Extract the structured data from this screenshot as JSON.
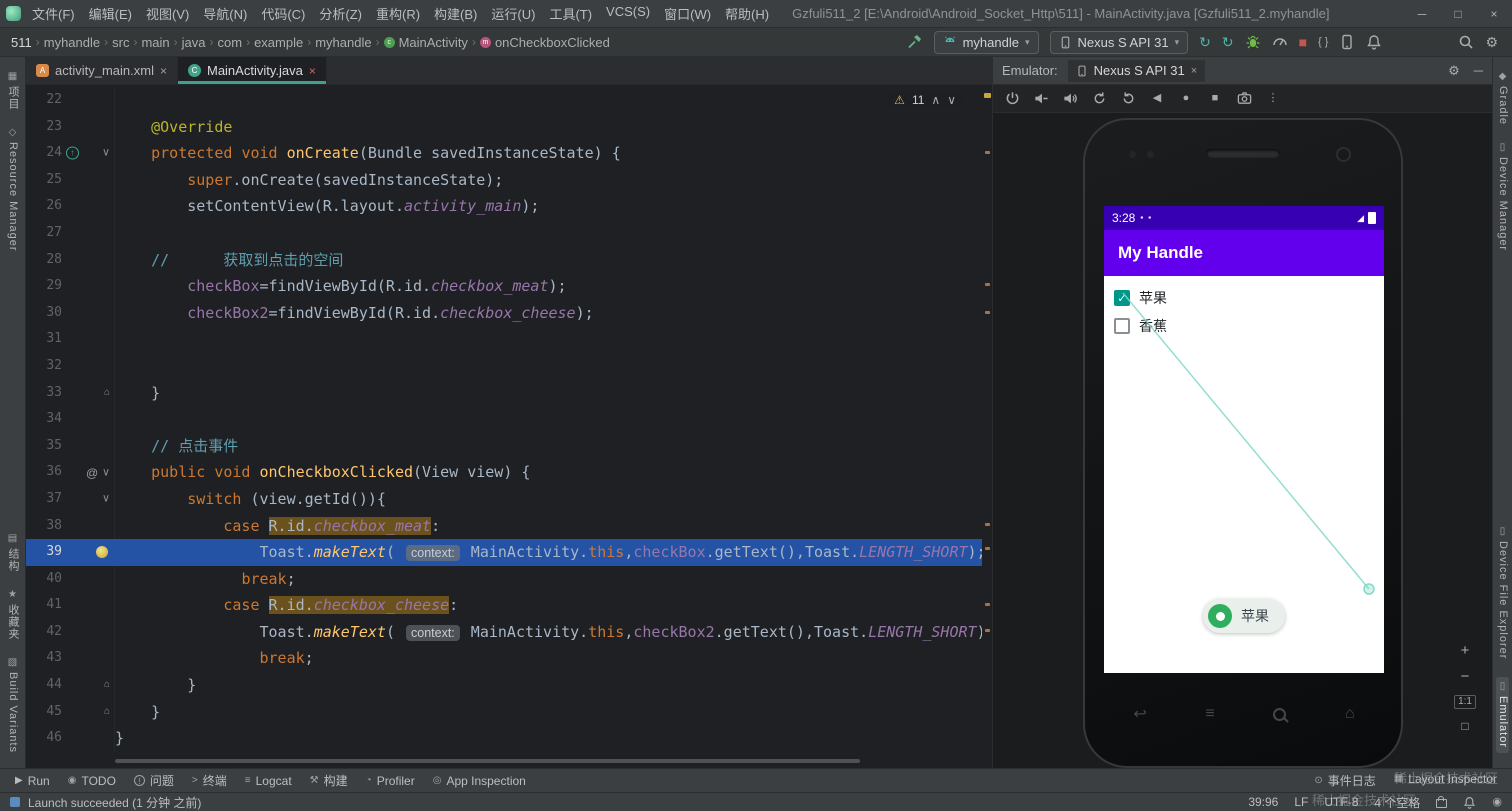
{
  "icons": {
    "chevron": "›",
    "dropdown": "▾",
    "minimize": "─",
    "maximize": "□",
    "close": "×",
    "gear": "⚙",
    "warning": "⚠",
    "up": "∧",
    "down": "∨",
    "back": "◀",
    "home": "●",
    "overview": "■",
    "more": "⋮",
    "stop": "■",
    "braces": "{ }",
    "sync": "↻",
    "override": "↑",
    "at": "@",
    "fold_end": "⌂",
    "check": "✓",
    "signal": "◢",
    "status_dot": "▪",
    "nav_back": "↩",
    "nav_menu": "≡",
    "nav_home": "⌂",
    "run": "▶",
    "todo": "◉",
    "problems": "!",
    "terminal": ">",
    "logcat": "≡",
    "build": "⚒",
    "profiler": "◔",
    "inspect": "◎",
    "eventlog": "⊙",
    "layout": "▦",
    "star": "★"
  },
  "titlebar": {
    "menus": [
      "文件(F)",
      "编辑(E)",
      "视图(V)",
      "导航(N)",
      "代码(C)",
      "分析(Z)",
      "重构(R)",
      "构建(B)",
      "运行(U)",
      "工具(T)",
      "VCS(S)",
      "窗口(W)",
      "帮助(H)"
    ],
    "title": "Gzfuli511_2 [E:\\Android\\Android_Socket_Http\\511] - MainActivity.java [Gzfuli511_2.myhandle]"
  },
  "navbar": {
    "breadcrumbs": [
      {
        "label": "511"
      },
      {
        "label": "myhandle"
      },
      {
        "label": "src"
      },
      {
        "label": "main"
      },
      {
        "label": "java"
      },
      {
        "label": "com"
      },
      {
        "label": "example"
      },
      {
        "label": "myhandle"
      },
      {
        "label": "MainActivity",
        "icon": "class"
      },
      {
        "label": "onCheckboxClicked",
        "icon": "method"
      }
    ],
    "module": "myhandle",
    "device": "Nexus S API 31"
  },
  "left_strip": {
    "top": [
      {
        "label": "项目",
        "ico": "▦"
      },
      {
        "label": "Resource Manager",
        "ico": "◇"
      }
    ],
    "bottom": [
      {
        "label": "结构",
        "ico": "▤"
      },
      {
        "label": "收藏夹",
        "ico": "★"
      },
      {
        "label": "Build Variants",
        "ico": "▧"
      }
    ]
  },
  "right_strip": {
    "top": [
      {
        "label": "Gradle",
        "ico": "◆"
      },
      {
        "label": "Device Manager",
        "ico": "▯"
      }
    ],
    "bottom": [
      {
        "label": "Device File Explorer",
        "ico": "▯"
      },
      {
        "label": "Emulator",
        "ico": "▯",
        "active": true
      }
    ]
  },
  "tabs": [
    {
      "label": "activity_main.xml",
      "active": false
    },
    {
      "label": "MainActivity.java",
      "active": true
    }
  ],
  "editor": {
    "warning_count": "11",
    "lines": [
      {
        "n": 22,
        "seg": []
      },
      {
        "n": 23,
        "seg": [
          [
            "    "
          ],
          [
            "@Override",
            "a"
          ]
        ]
      },
      {
        "n": 24,
        "g": [
          "ovr",
          "fold"
        ],
        "seg": [
          [
            "    "
          ],
          [
            "protected",
            "k"
          ],
          [
            " "
          ],
          [
            "void",
            "k"
          ],
          [
            " "
          ],
          [
            "onCreate",
            "m"
          ],
          [
            "(Bundle savedInstanceState) {"
          ]
        ]
      },
      {
        "n": 25,
        "seg": [
          [
            "        "
          ],
          [
            "super",
            "k"
          ],
          [
            ".onCreate(savedInstanceState);"
          ]
        ]
      },
      {
        "n": 26,
        "seg": [
          [
            "        setContentView(R.layout."
          ],
          [
            "activity_main",
            "fi"
          ],
          [
            ");"
          ]
        ]
      },
      {
        "n": 27,
        "seg": []
      },
      {
        "n": 28,
        "seg": [
          [
            "    "
          ],
          [
            "//      获取到点击的空间",
            "c"
          ]
        ]
      },
      {
        "n": 29,
        "seg": [
          [
            "        "
          ],
          [
            "checkBox",
            "f"
          ],
          [
            "=findViewById(R.id."
          ],
          [
            "checkbox_meat",
            "fi"
          ],
          [
            ");"
          ]
        ]
      },
      {
        "n": 30,
        "seg": [
          [
            "        "
          ],
          [
            "checkBox2",
            "f"
          ],
          [
            "=findViewById(R.id."
          ],
          [
            "checkbox_cheese",
            "fi"
          ],
          [
            ");"
          ]
        ]
      },
      {
        "n": 31,
        "seg": []
      },
      {
        "n": 32,
        "seg": []
      },
      {
        "n": 33,
        "g": [
          "fend"
        ],
        "seg": [
          [
            "    }"
          ]
        ]
      },
      {
        "n": 34,
        "seg": []
      },
      {
        "n": 35,
        "seg": [
          [
            "    "
          ],
          [
            "// 点击事件",
            "c"
          ]
        ]
      },
      {
        "n": 36,
        "g": [
          "at",
          "fold"
        ],
        "seg": [
          [
            "    "
          ],
          [
            "public",
            "k"
          ],
          [
            " "
          ],
          [
            "void",
            "k"
          ],
          [
            " "
          ],
          [
            "onCheckboxClicked",
            "m"
          ],
          [
            "(View view) {"
          ]
        ]
      },
      {
        "n": 37,
        "g": [
          "fold"
        ],
        "seg": [
          [
            "        "
          ],
          [
            "switch",
            "k"
          ],
          [
            " (view.getId()){"
          ]
        ]
      },
      {
        "n": 38,
        "seg": [
          [
            "            "
          ],
          [
            "case",
            "k"
          ],
          [
            " "
          ],
          [
            "R.id.",
            "occ"
          ],
          [
            "checkbox_meat",
            "fi occ"
          ],
          [
            ":"
          ]
        ]
      },
      {
        "n": 39,
        "sel": true,
        "g": [
          "bulb"
        ],
        "seg": [
          [
            "                Toast."
          ],
          [
            "makeText",
            "mi"
          ],
          [
            "( "
          ],
          [
            "context:",
            "chip"
          ],
          [
            " MainActivity."
          ],
          [
            "this",
            "k"
          ],
          [
            ","
          ],
          [
            "checkBox",
            "f"
          ],
          [
            ".getText(),Toast."
          ],
          [
            "LENGTH_SHORT",
            "fi"
          ],
          [
            ");"
          ]
        ]
      },
      {
        "n": 40,
        "seg": [
          [
            "              "
          ],
          [
            "break",
            "k"
          ],
          [
            ";"
          ]
        ]
      },
      {
        "n": 41,
        "seg": [
          [
            "            "
          ],
          [
            "case",
            "k"
          ],
          [
            " "
          ],
          [
            "R.id.",
            "occ"
          ],
          [
            "checkbox_cheese",
            "fi occ"
          ],
          [
            ":"
          ]
        ]
      },
      {
        "n": 42,
        "seg": [
          [
            "                Toast."
          ],
          [
            "makeText",
            "mi"
          ],
          [
            "( "
          ],
          [
            "context:",
            "chip"
          ],
          [
            " MainActivity."
          ],
          [
            "this",
            "k"
          ],
          [
            ","
          ],
          [
            "checkBox2",
            "f"
          ],
          [
            ".getText(),Toast."
          ],
          [
            "LENGTH_SHORT",
            "fi"
          ],
          [
            ");"
          ]
        ]
      },
      {
        "n": 43,
        "seg": [
          [
            "                "
          ],
          [
            "break",
            "k"
          ],
          [
            ";"
          ]
        ]
      },
      {
        "n": 44,
        "g": [
          "fend"
        ],
        "seg": [
          [
            "        }"
          ]
        ]
      },
      {
        "n": 45,
        "g": [
          "fend"
        ],
        "seg": [
          [
            "    }"
          ]
        ]
      },
      {
        "n": 46,
        "seg": [
          [
            "}"
          ]
        ]
      }
    ]
  },
  "emulator": {
    "header_label": "Emulator:",
    "tab_label": "Nexus S API 31",
    "toolbar": [
      "power",
      "volume-down",
      "volume-up",
      "rotate-left",
      "rotate-right",
      "back",
      "home",
      "overview",
      "camera",
      "more"
    ],
    "zoom": [
      "+",
      "−",
      "1:1"
    ],
    "phone": {
      "time": "3:28",
      "app_title": "My Handle",
      "checkboxes": [
        {
          "label": "苹果",
          "checked": true
        },
        {
          "label": "香蕉",
          "checked": false
        }
      ],
      "toast": "苹果"
    }
  },
  "bottombar": {
    "left": [
      {
        "icon": "run",
        "label": "Run"
      },
      {
        "icon": "todo",
        "label": "TODO"
      },
      {
        "icon": "problems",
        "label": "问题"
      },
      {
        "icon": "terminal",
        "label": "终端"
      },
      {
        "icon": "logcat",
        "label": "Logcat"
      },
      {
        "icon": "build",
        "label": "构建"
      },
      {
        "icon": "profiler",
        "label": "Profiler"
      },
      {
        "icon": "inspect",
        "label": "App Inspection"
      }
    ],
    "right": [
      {
        "icon": "eventlog",
        "label": "事件日志"
      },
      {
        "icon": "layout",
        "label": "Layout Inspector"
      }
    ]
  },
  "statusbar": {
    "message": "Launch succeeded (1 分钟 之前)",
    "position": "39:96",
    "line_ending": "LF",
    "encoding": "UTF-8",
    "indent": "4 个空格"
  },
  "watermark": "稀土掘金技术社区"
}
